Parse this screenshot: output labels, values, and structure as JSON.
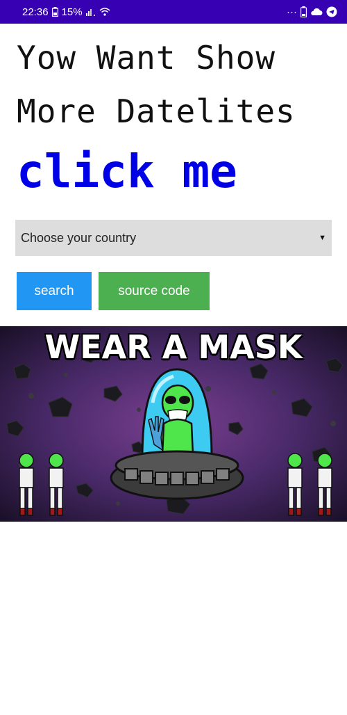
{
  "status_bar": {
    "time": "22:36",
    "battery": "15%",
    "overflow": "···"
  },
  "content": {
    "heading_line1": "Yow Want Show",
    "heading_line2": "More Datelites",
    "link_text": "click me",
    "country_select": {
      "selected": "Choose your country"
    },
    "buttons": {
      "search_label": "search",
      "source_label": "source code",
      "search_color": "#2196f3",
      "source_color": "#4caf50"
    },
    "banner": {
      "caption": "WEAR A MASK"
    }
  },
  "colors": {
    "status_bar": "#3700b3",
    "link": "#0000e6"
  }
}
